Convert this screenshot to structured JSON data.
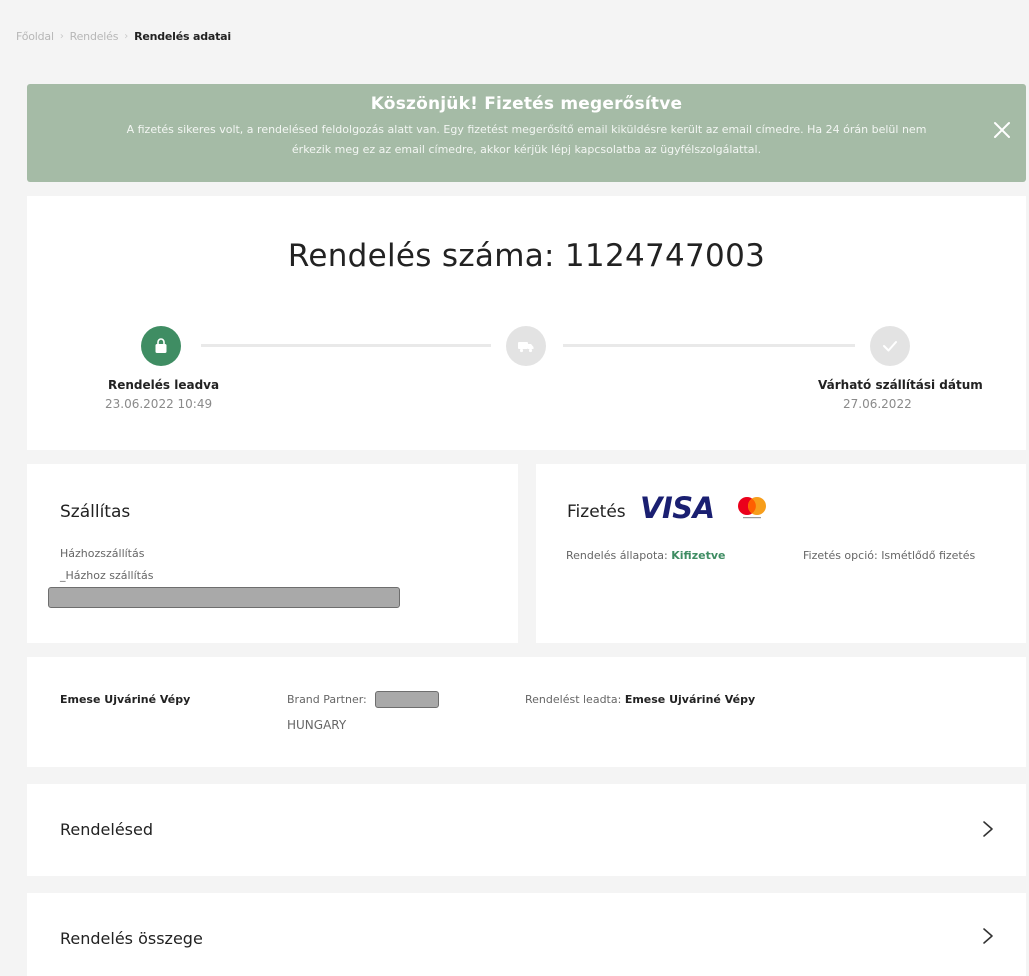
{
  "breadcrumb": {
    "items": [
      "Főoldal",
      "Rendelés",
      "Rendelés adatai"
    ]
  },
  "banner": {
    "title": "Köszönjük! Fizetés megerősítve",
    "line1": "A fizetés sikeres volt, a rendelésed feldolgozás alatt van. Egy fizetést megerősítő email kiküldésre került az email címedre. Ha 24 órán belül nem",
    "line2": "érkezik meg ez az email címedre, akkor kérjük lépj kapcsolatba az ügyfélszolgálattal.",
    "close_icon": "close-icon"
  },
  "order": {
    "number_text": "Rendelés száma: 1124747003",
    "steps": [
      {
        "label": "Rendelés leadva",
        "date": "23.06.2022 10:49",
        "icon": "shopping-bag-icon",
        "status": "done"
      },
      {
        "label": "",
        "date": "",
        "icon": "truck-icon",
        "status": "pending"
      },
      {
        "label": "Várható szállítási dátum",
        "date": "27.06.2022",
        "icon": "check-icon",
        "status": "pending"
      }
    ]
  },
  "shipping": {
    "title": "Szállítas",
    "method": "Házhozszállítás",
    "method_detail": "_Házhoz szállítás",
    "address_redacted": true
  },
  "payment": {
    "title": "Fizetés",
    "brand_visa": "VISA",
    "brand_mastercard": "mastercard-logo",
    "status_label": "Rendelés állapota:",
    "status_value": "Kifizetve",
    "option_label": "Fizetés opció:",
    "option_value": "Ismétlődő fizetés"
  },
  "person": {
    "name": "Emese Ujváriné Vépy",
    "partner_label": "Brand Partner:",
    "partner_country": "HUNGARY",
    "placed_by_label": "Rendelést leadta:",
    "placed_by_name": "Emese Ujváriné Vépy"
  },
  "sections": {
    "order_items": "Rendelésed",
    "order_total": "Rendelés összege"
  },
  "colors": {
    "banner_bg": "#a5bba6",
    "accent_green": "#3f8d63",
    "visa_blue": "#1a1f71",
    "page_bg": "#f4f4f4"
  }
}
